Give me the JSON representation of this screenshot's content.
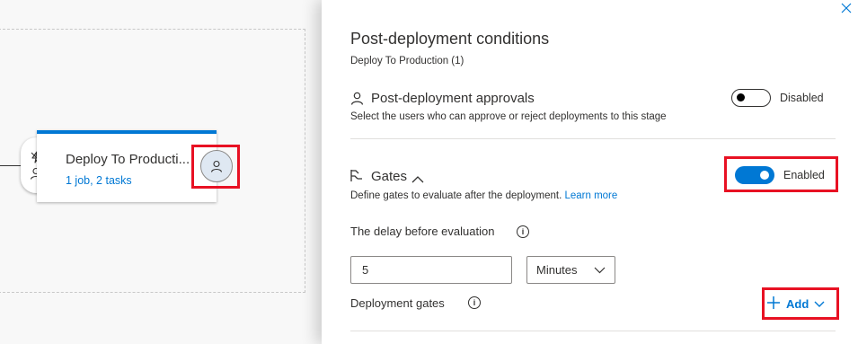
{
  "canvas": {
    "stage": {
      "name": "Deploy To Producti...",
      "summary": "1 job, 2 tasks"
    }
  },
  "panel": {
    "title": "Post-deployment conditions",
    "subtitle": "Deploy To Production (1)",
    "approvals": {
      "title": "Post-deployment approvals",
      "description": "Select the users who can approve or reject deployments to this stage",
      "toggle_state": "Disabled",
      "enabled": false
    },
    "gates": {
      "title": "Gates",
      "description": "Define gates to evaluate after the deployment.",
      "learn_more": "Learn more",
      "toggle_state": "Enabled",
      "enabled": true,
      "delay_label": "The delay before evaluation",
      "delay_value": "5",
      "delay_unit": "Minutes",
      "deployment_gates_label": "Deployment gates",
      "add_label": "Add"
    }
  },
  "colors": {
    "accent": "#0078d4",
    "highlight": "#e81123"
  }
}
